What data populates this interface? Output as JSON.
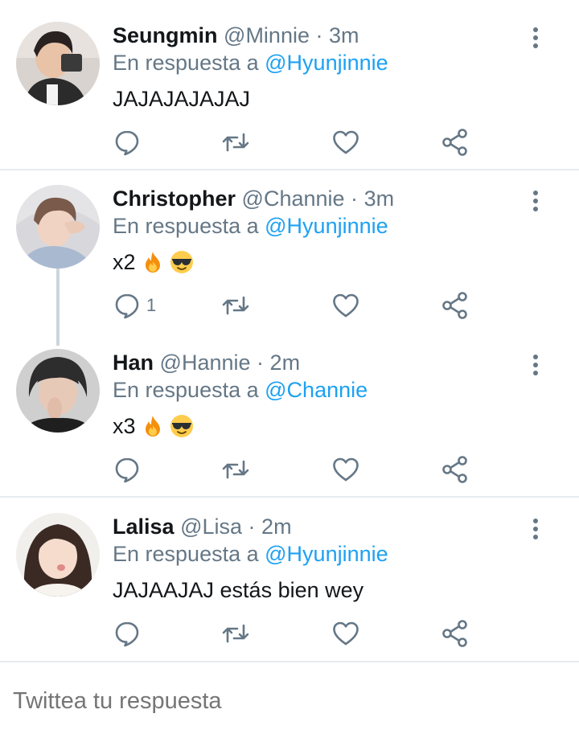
{
  "colors": {
    "accent": "#1da1f2",
    "secondary": "#657786",
    "divider": "#e6ecf0",
    "thread": "#ccd6dd"
  },
  "tweets": [
    {
      "name": "Seungmin",
      "handle": "@Minnie",
      "dot": "·",
      "time": "3m",
      "reply_prefix": "En respuesta a",
      "reply_to": "@Hyunjinnie",
      "text": "JAJAJAJAJAJ",
      "emojis": [],
      "reply_count": ""
    },
    {
      "name": "Christopher",
      "handle": "@Channie",
      "dot": "·",
      "time": "3m",
      "reply_prefix": "En respuesta a",
      "reply_to": "@Hyunjinnie",
      "text": "x2",
      "emojis": [
        "fire-emoji",
        "sunglasses-emoji"
      ],
      "reply_count": "1"
    },
    {
      "name": "Han",
      "handle": "@Hannie",
      "dot": "·",
      "time": "2m",
      "reply_prefix": "En respuesta a",
      "reply_to": "@Channie",
      "text": "x3",
      "emojis": [
        "fire-emoji",
        "sunglasses-emoji"
      ],
      "reply_count": ""
    },
    {
      "name": "Lalisa",
      "handle": "@Lisa",
      "dot": "·",
      "time": "2m",
      "reply_prefix": "En respuesta a",
      "reply_to": "@Hyunjinnie",
      "text": "JAJAAJAJ estás bien wey",
      "emojis": [],
      "reply_count": ""
    }
  ],
  "compose": {
    "placeholder": "Twittea tu respuesta"
  }
}
